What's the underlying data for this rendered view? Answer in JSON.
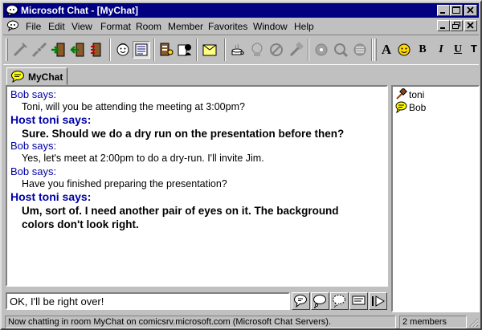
{
  "window": {
    "title": "Microsoft Chat - [MyChat]",
    "title_bar_color": "#000080"
  },
  "menu": [
    "File",
    "Edit",
    "View",
    "Format",
    "Room",
    "Member",
    "Favorites",
    "Window",
    "Help"
  ],
  "toolbar": {
    "tools": [
      "connect-icon",
      "disconnect-icon",
      "enter-room-icon",
      "leave-room-icon",
      "room-list-icon",
      "user-list-icon",
      "comic-view-icon",
      "text-view-icon",
      "get-profile-icon",
      "identity-icon",
      "whisper-box-icon",
      "invite-icon",
      "away-icon",
      "ignore-icon",
      "kick-icon",
      "ban-icon",
      "sound-icon",
      "play-sound-icon",
      "nm-icon"
    ],
    "format": {
      "font": "A",
      "bold": "B",
      "italic": "I",
      "underline": "U",
      "fixed": "T"
    }
  },
  "tab": {
    "label": "MyChat"
  },
  "messages": [
    {
      "speaker": "Bob says:",
      "host": false,
      "text": "Toni, will you be attending the meeting at 3:00pm?"
    },
    {
      "speaker": "Host toni says:",
      "host": true,
      "text": "Sure. Should we do a dry run on the presentation before then?"
    },
    {
      "speaker": "Bob says:",
      "host": false,
      "text": "Yes, let's meet at 2:00pm to do a dry-run. I'll invite Jim."
    },
    {
      "speaker": "Bob says:",
      "host": false,
      "text": "Have you finished preparing the presentation?"
    },
    {
      "speaker": "Host toni says:",
      "host": true,
      "text": "Um, sort of. I need another pair of eyes on it. The background colors don't look right."
    }
  ],
  "members": [
    {
      "name": "toni",
      "icon": "host-gavel-icon"
    },
    {
      "name": "Bob",
      "icon": "speech-bubble-icon"
    }
  ],
  "input": {
    "value": "OK, I'll be right over!"
  },
  "input_buttons": [
    "say-icon",
    "think-icon",
    "whisper-icon",
    "action-icon",
    "sound-send-icon"
  ],
  "status": {
    "text": "Now chatting in room MyChat on comicsrv.microsoft.com (Microsoft Chat Servers).",
    "count": "2 members"
  }
}
